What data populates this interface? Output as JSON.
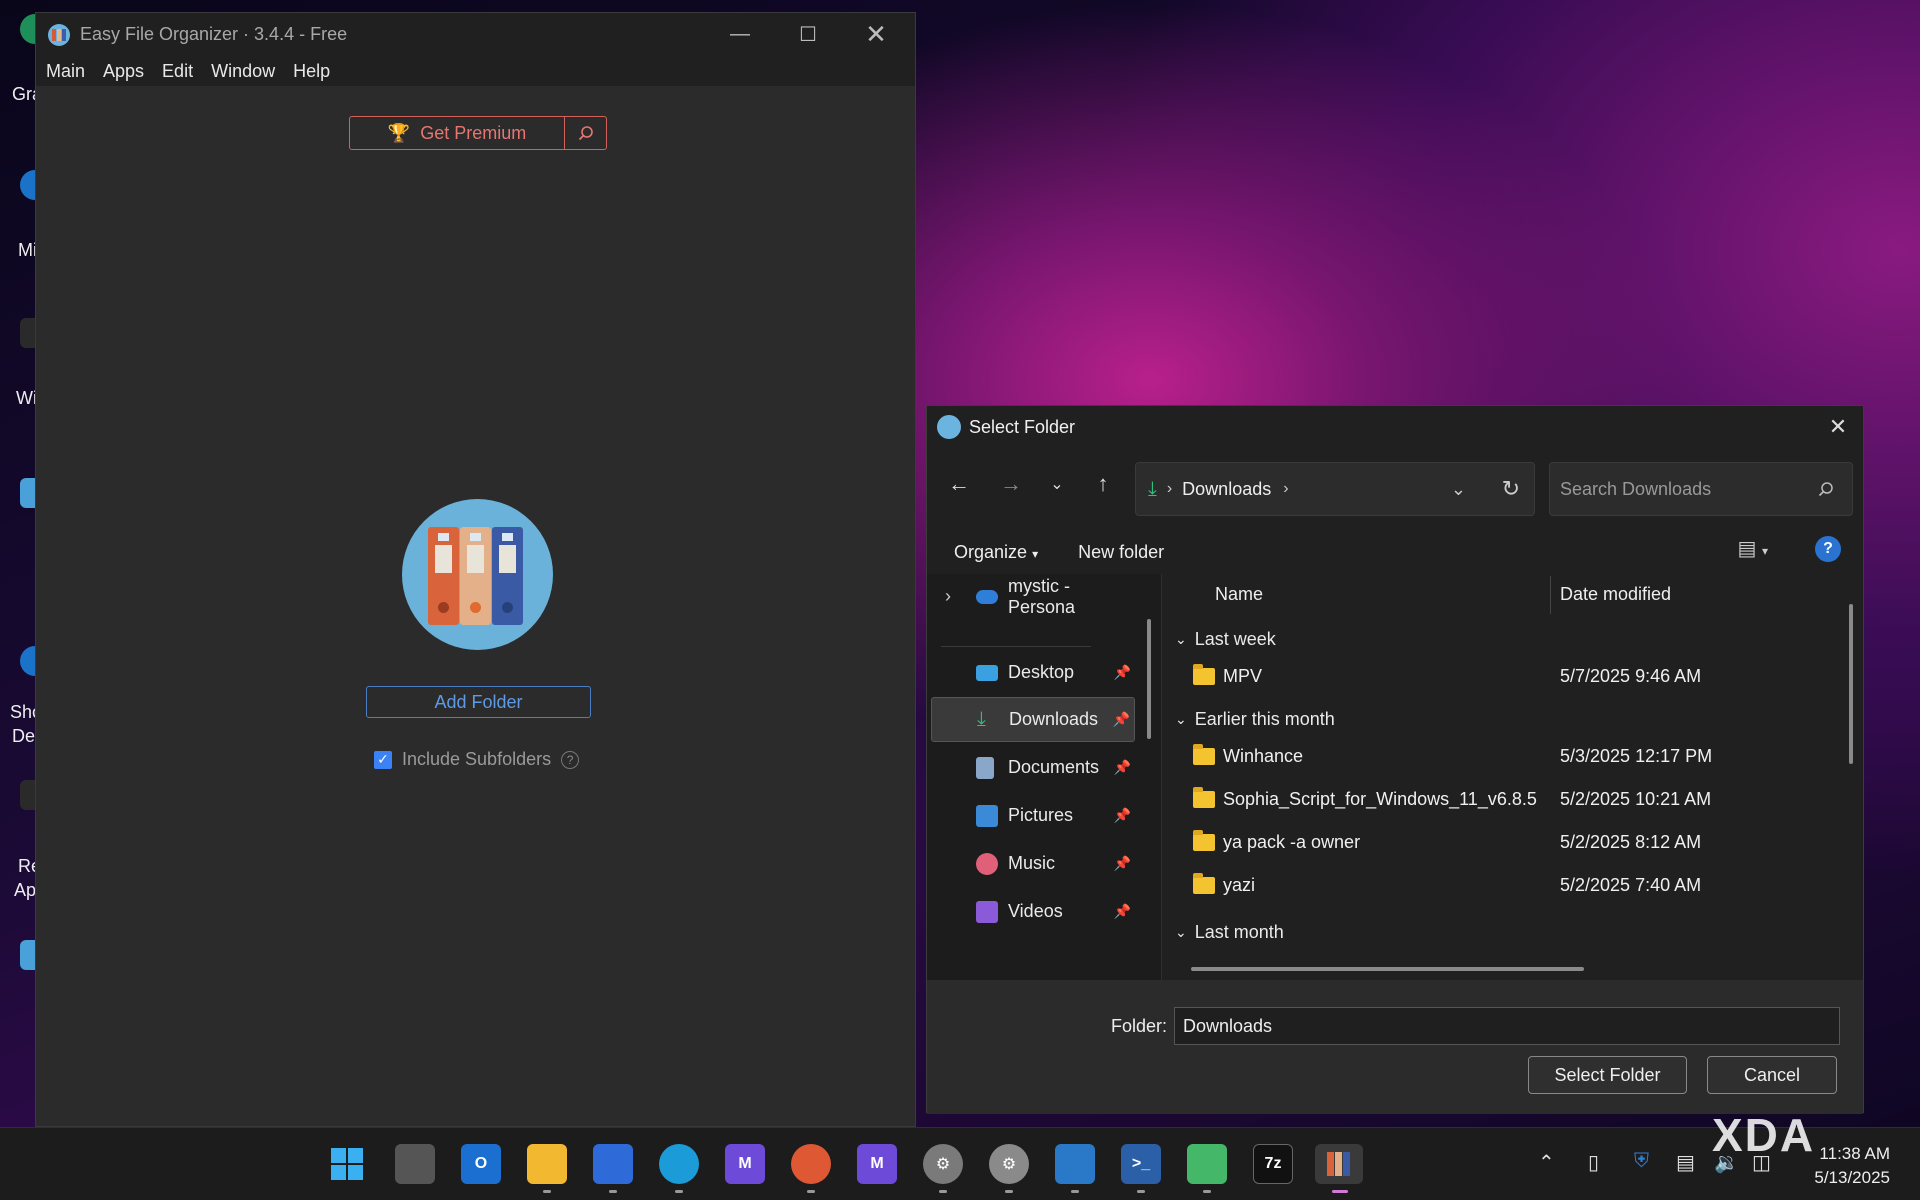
{
  "desktop": {
    "icons": [
      {
        "label": "Gra",
        "color": "#1f8f5a"
      },
      {
        "label": "Mi",
        "color": "#1a73c8"
      },
      {
        "label": "Wi",
        "color": "#2a2a2a"
      },
      {
        "label": "",
        "color": "#4aa0d8"
      },
      {
        "label": "Sho",
        "color": "#1a73c8"
      },
      {
        "label": "Des",
        "color": ""
      },
      {
        "label": "Re",
        "color": "#2a2a2a"
      },
      {
        "label": "Ap",
        "color": ""
      },
      {
        "label": "",
        "color": "#4aa0d8"
      }
    ]
  },
  "app": {
    "title": "Easy File Organizer · 3.4.4 - Free",
    "menu": [
      "Main",
      "Apps",
      "Edit",
      "Window",
      "Help"
    ],
    "premium_label": "Get Premium",
    "add_folder_label": "Add Folder",
    "include_subfolders_label": "Include Subfolders",
    "include_subfolders_checked": true
  },
  "dialog": {
    "title": "Select Folder",
    "address": {
      "current": "Downloads"
    },
    "search_placeholder": "Search Downloads",
    "organize_label": "Organize",
    "new_folder_label": "New folder",
    "nav": [
      {
        "label": "mystic - Persona",
        "icon": "onedrive-icon"
      },
      {
        "label": "Desktop",
        "icon": "desktop-icon",
        "pinned": true
      },
      {
        "label": "Downloads",
        "icon": "download-icon",
        "pinned": true,
        "selected": true
      },
      {
        "label": "Documents",
        "icon": "documents-icon",
        "pinned": true
      },
      {
        "label": "Pictures",
        "icon": "pictures-icon",
        "pinned": true
      },
      {
        "label": "Music",
        "icon": "music-icon",
        "pinned": true
      },
      {
        "label": "Videos",
        "icon": "videos-icon",
        "pinned": true
      }
    ],
    "columns": {
      "name": "Name",
      "date": "Date modified"
    },
    "groups": [
      {
        "label": "Last week",
        "items": [
          {
            "name": "MPV",
            "date": "5/7/2025 9:46 AM"
          }
        ]
      },
      {
        "label": "Earlier this month",
        "items": [
          {
            "name": "Winhance",
            "date": "5/3/2025 12:17 PM"
          },
          {
            "name": "Sophia_Script_for_Windows_11_v6.8.5",
            "date": "5/2/2025 10:21 AM"
          },
          {
            "name": "ya pack -a owner",
            "date": "5/2/2025 8:12 AM"
          },
          {
            "name": "yazi",
            "date": "5/2/2025 7:40 AM"
          }
        ]
      },
      {
        "label": "Last month",
        "items": []
      }
    ],
    "folder_label": "Folder:",
    "folder_value": "Downloads",
    "select_button": "Select Folder",
    "cancel_button": "Cancel"
  },
  "taskbar": {
    "time": "11:38 AM",
    "date": "5/13/2025",
    "apps": [
      "start",
      "task-view",
      "outlook",
      "file-explorer",
      "store",
      "edge",
      "proton-mail",
      "duckduckgo",
      "proton-mail-2",
      "settings",
      "settings-2",
      "photos",
      "terminal",
      "pinwheel",
      "7zip",
      "easy-file-organizer"
    ]
  },
  "watermark": "XDA"
}
